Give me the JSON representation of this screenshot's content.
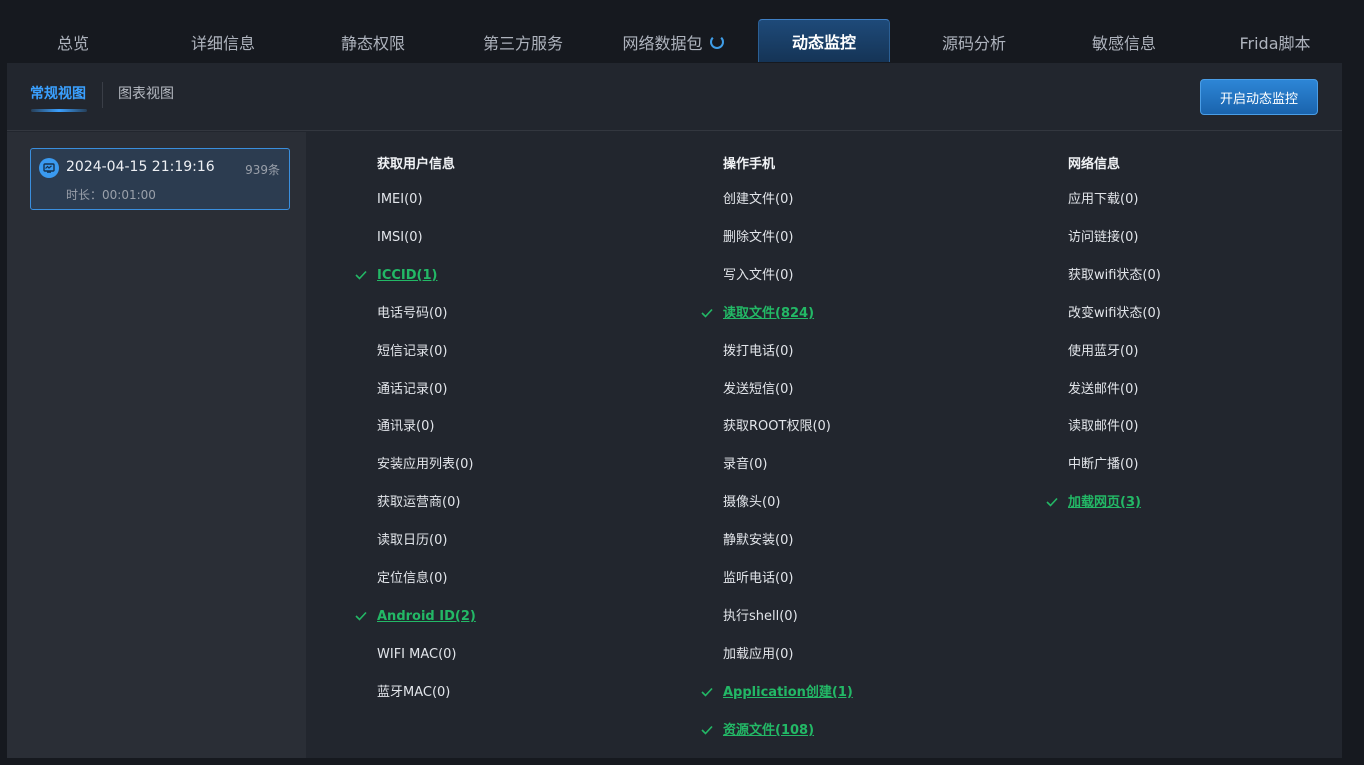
{
  "tabs": [
    {
      "label": "总览"
    },
    {
      "label": "详细信息"
    },
    {
      "label": "静态权限"
    },
    {
      "label": "第三方服务"
    },
    {
      "label": "网络数据包"
    },
    {
      "label": "动态监控"
    },
    {
      "label": "源码分析"
    },
    {
      "label": "敏感信息"
    },
    {
      "label": "Frida脚本"
    }
  ],
  "subtabs": {
    "normal": "常规视图",
    "chart": "图表视图"
  },
  "start_button": "开启动态监控",
  "session": {
    "date": "2024-04-15 21:19:16",
    "count": "939条",
    "duration": "时长：00:01:00"
  },
  "columns": [
    {
      "title": "获取用户信息",
      "items": [
        {
          "label": "IMEI(0)",
          "hit": false
        },
        {
          "label": "IMSI(0)",
          "hit": false
        },
        {
          "label": "ICCID(1)",
          "hit": true
        },
        {
          "label": "电话号码(0)",
          "hit": false
        },
        {
          "label": "短信记录(0)",
          "hit": false
        },
        {
          "label": "通话记录(0)",
          "hit": false
        },
        {
          "label": "通讯录(0)",
          "hit": false
        },
        {
          "label": "安装应用列表(0)",
          "hit": false
        },
        {
          "label": "获取运营商(0)",
          "hit": false
        },
        {
          "label": "读取日历(0)",
          "hit": false
        },
        {
          "label": "定位信息(0)",
          "hit": false
        },
        {
          "label": "Android ID(2)",
          "hit": true
        },
        {
          "label": "WIFI MAC(0)",
          "hit": false
        },
        {
          "label": "蓝牙MAC(0)",
          "hit": false
        }
      ]
    },
    {
      "title": "操作手机",
      "items": [
        {
          "label": "创建文件(0)",
          "hit": false
        },
        {
          "label": "删除文件(0)",
          "hit": false
        },
        {
          "label": "写入文件(0)",
          "hit": false
        },
        {
          "label": "读取文件(824)",
          "hit": true
        },
        {
          "label": "拨打电话(0)",
          "hit": false
        },
        {
          "label": "发送短信(0)",
          "hit": false
        },
        {
          "label": "获取ROOT权限(0)",
          "hit": false
        },
        {
          "label": "录音(0)",
          "hit": false
        },
        {
          "label": "摄像头(0)",
          "hit": false
        },
        {
          "label": "静默安装(0)",
          "hit": false
        },
        {
          "label": "监听电话(0)",
          "hit": false
        },
        {
          "label": "执行shell(0)",
          "hit": false
        },
        {
          "label": "加载应用(0)",
          "hit": false
        },
        {
          "label": "Application创建(1)",
          "hit": true
        },
        {
          "label": "资源文件(108)",
          "hit": true
        }
      ]
    },
    {
      "title": "网络信息",
      "items": [
        {
          "label": "应用下载(0)",
          "hit": false
        },
        {
          "label": "访问链接(0)",
          "hit": false
        },
        {
          "label": "获取wifi状态(0)",
          "hit": false
        },
        {
          "label": "改变wifi状态(0)",
          "hit": false
        },
        {
          "label": "使用蓝牙(0)",
          "hit": false
        },
        {
          "label": "发送邮件(0)",
          "hit": false
        },
        {
          "label": "读取邮件(0)",
          "hit": false
        },
        {
          "label": "中断广播(0)",
          "hit": false
        },
        {
          "label": "加载网页(3)",
          "hit": true
        }
      ]
    }
  ]
}
